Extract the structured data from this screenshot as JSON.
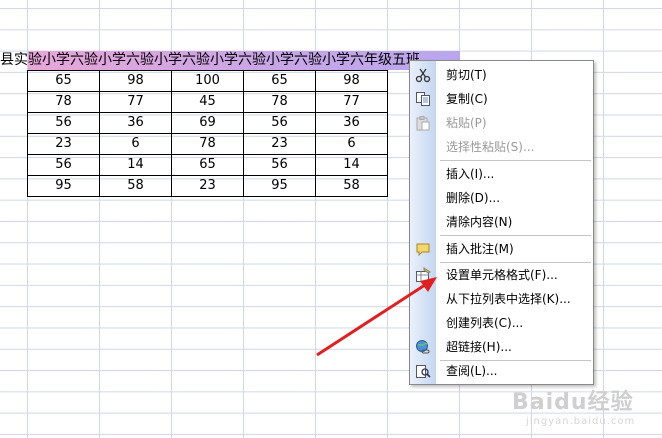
{
  "title_row": {
    "text": "县实验小学六年级五班验小学六年级五班验小学六年级五班验小学六年级五班验小学六年级五班",
    "visible_text": "县实验小学六验小学六验小学六验小学六验小学六验小学六年级五班"
  },
  "table": {
    "rows": [
      [
        "65",
        "98",
        "100",
        "65",
        "98"
      ],
      [
        "78",
        "77",
        "45",
        "78",
        "77"
      ],
      [
        "56",
        "36",
        "69",
        "56",
        "36"
      ],
      [
        "23",
        "6",
        "78",
        "23",
        "6"
      ],
      [
        "56",
        "14",
        "65",
        "56",
        "14"
      ],
      [
        "95",
        "58",
        "23",
        "95",
        "58"
      ]
    ]
  },
  "context_menu": {
    "items": [
      {
        "label": "剪切(T)",
        "icon": "scissors-icon",
        "disabled": false
      },
      {
        "label": "复制(C)",
        "icon": "copy-icon",
        "disabled": false
      },
      {
        "label": "粘贴(P)",
        "icon": "paste-icon",
        "disabled": true
      },
      {
        "label": "选择性粘贴(S)...",
        "icon": "",
        "disabled": true
      },
      {
        "label": "插入(I)...",
        "icon": "",
        "disabled": false
      },
      {
        "label": "删除(D)...",
        "icon": "",
        "disabled": false
      },
      {
        "label": "清除内容(N)",
        "icon": "",
        "disabled": false
      },
      {
        "label": "插入批注(M)",
        "icon": "comment-icon",
        "disabled": false
      },
      {
        "label": "设置单元格格式(F)...",
        "icon": "format-cells-icon",
        "disabled": false
      },
      {
        "label": "从下拉列表中选择(K)...",
        "icon": "",
        "disabled": false
      },
      {
        "label": "创建列表(C)...",
        "icon": "",
        "disabled": false
      },
      {
        "label": "超链接(H)...",
        "icon": "hyperlink-icon",
        "disabled": false
      },
      {
        "label": "查阅(L)...",
        "icon": "research-icon",
        "disabled": false
      }
    ]
  },
  "watermark": {
    "text": "Baidu经验",
    "sub": "jingyan.baidu.com"
  },
  "colors": {
    "selection_start": "#e8a6d8",
    "selection_end": "#b9a6ee",
    "arrow": "#e02020",
    "gridline": "#d0d7e5"
  }
}
